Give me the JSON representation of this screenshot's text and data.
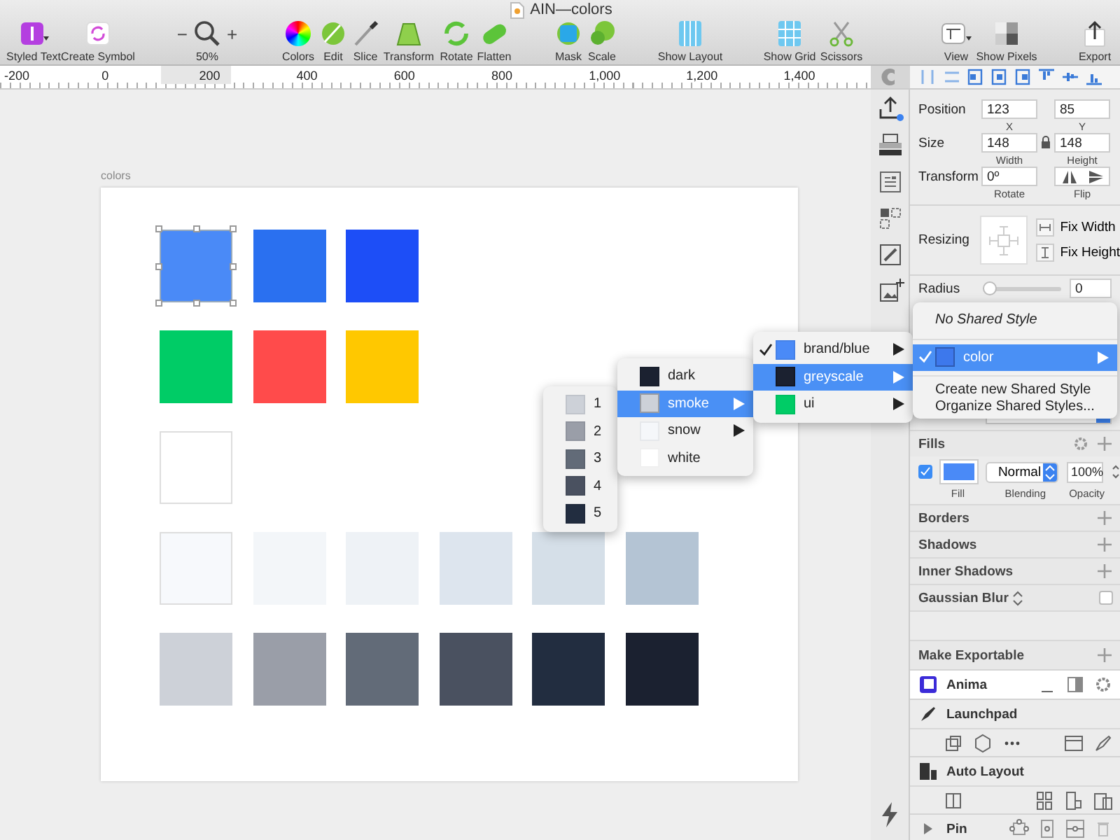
{
  "window": {
    "title": "AIN—colors"
  },
  "toolbar": [
    {
      "kind": "styled-text",
      "label": "Styled Text"
    },
    {
      "kind": "symbol",
      "label": "Create Symbol"
    },
    {
      "kind": "zoom",
      "label": "50%",
      "minus": "−",
      "plus": "+"
    },
    {
      "kind": "colors",
      "label": "Colors"
    },
    {
      "kind": "edit",
      "label": "Edit"
    },
    {
      "kind": "slice",
      "label": "Slice"
    },
    {
      "kind": "transform",
      "label": "Transform"
    },
    {
      "kind": "rotate",
      "label": "Rotate"
    },
    {
      "kind": "flatten",
      "label": "Flatten"
    },
    {
      "kind": "mask",
      "label": "Mask"
    },
    {
      "kind": "scale",
      "label": "Scale"
    },
    {
      "kind": "layout",
      "label": "Show Layout"
    },
    {
      "kind": "grid",
      "label": "Show Grid"
    },
    {
      "kind": "scissors",
      "label": "Scissors"
    },
    {
      "kind": "view",
      "label": "View"
    },
    {
      "kind": "pixels",
      "label": "Show Pixels"
    },
    {
      "kind": "export",
      "label": "Export"
    }
  ],
  "ruler": {
    "labels": [
      "-200",
      "0",
      "200",
      "400",
      "600",
      "800",
      "1,000",
      "1,200",
      "1,400"
    ]
  },
  "artboard": {
    "title": "colors",
    "rows": [
      {
        "swatches": [
          {
            "color": "#4a8af7",
            "selected": true
          },
          {
            "color": "#2a70f0",
            "selected": false
          },
          {
            "color": "#1d4ef7",
            "selected": false
          }
        ]
      },
      {
        "swatches": [
          {
            "color": "#00cc66",
            "selected": false
          },
          {
            "color": "#ff4b4b",
            "selected": false
          },
          {
            "color": "#ffc800",
            "selected": false
          }
        ]
      },
      {
        "swatches": [
          {
            "color": "#ffffff",
            "selected": false
          }
        ]
      },
      {
        "swatches": [
          {
            "color": "#f7f9fc",
            "selected": false
          },
          {
            "color": "#f3f6f9",
            "selected": false
          },
          {
            "color": "#eef2f6",
            "selected": false
          },
          {
            "color": "#dde5ee",
            "selected": false
          },
          {
            "color": "#d5dfe8",
            "selected": false
          },
          {
            "color": "#b4c4d4",
            "selected": false
          }
        ]
      },
      {
        "swatches": [
          {
            "color": "#cdd1d8",
            "selected": false
          },
          {
            "color": "#9a9ea8",
            "selected": false
          },
          {
            "color": "#626b78",
            "selected": false
          },
          {
            "color": "#4a5160",
            "selected": false
          },
          {
            "color": "#222d40",
            "selected": false
          },
          {
            "color": "#1b2130",
            "selected": false
          }
        ]
      }
    ]
  },
  "menus": [
    {
      "items": [
        {
          "kind": "color",
          "label": "1",
          "color": "#cdd1d8",
          "checked": false,
          "selected": false,
          "submenu": false
        },
        {
          "kind": "color",
          "label": "2",
          "color": "#9a9ea8",
          "checked": false,
          "selected": false,
          "submenu": false
        },
        {
          "kind": "color",
          "label": "3",
          "color": "#626b78",
          "checked": false,
          "selected": false,
          "submenu": false
        },
        {
          "kind": "color",
          "label": "4",
          "color": "#4a5160",
          "checked": false,
          "selected": false,
          "submenu": false
        },
        {
          "kind": "color",
          "label": "5",
          "color": "#222d40",
          "checked": false,
          "selected": false,
          "submenu": false
        }
      ]
    },
    {
      "items": [
        {
          "kind": "color",
          "label": "dark",
          "color": "#1b2130",
          "checked": false,
          "selected": false,
          "submenu": false
        },
        {
          "kind": "color",
          "label": "smoke",
          "color": "#cdd1d8",
          "checked": false,
          "selected": true,
          "submenu": true
        },
        {
          "kind": "color",
          "label": "snow",
          "color": "#f5f7fa",
          "checked": false,
          "selected": false,
          "submenu": true
        },
        {
          "kind": "color",
          "label": "white",
          "color": "#ffffff",
          "checked": false,
          "selected": false,
          "submenu": false
        }
      ]
    },
    {
      "items": [
        {
          "kind": "color",
          "label": "brand/blue",
          "color": "#4a8af7",
          "checked": true,
          "selected": false,
          "submenu": true
        },
        {
          "kind": "color",
          "label": "greyscale",
          "color": "#1b2130",
          "checked": false,
          "selected": true,
          "submenu": true
        },
        {
          "kind": "color",
          "label": "ui",
          "color": "#00cc66",
          "checked": false,
          "selected": false,
          "submenu": true
        }
      ]
    },
    {
      "items": [
        {
          "kind": "header",
          "label": "No Shared Style",
          "checked": false,
          "selected": false,
          "submenu": false
        },
        {
          "kind": "color",
          "label": "color",
          "color": "#3d78ec",
          "checked": true,
          "selected": true,
          "submenu": true
        },
        {
          "kind": "action",
          "label": "Create new Shared Style",
          "checked": false,
          "selected": false,
          "submenu": false
        },
        {
          "kind": "action",
          "label": "Organize Shared Styles...",
          "checked": false,
          "selected": false,
          "submenu": false
        }
      ]
    }
  ],
  "inspector": {
    "position": {
      "label": "Position",
      "x": {
        "value": "123",
        "caption": "X"
      },
      "y": {
        "value": "85",
        "caption": "Y"
      }
    },
    "size": {
      "label": "Size",
      "width": {
        "value": "148",
        "caption": "Width"
      },
      "height": {
        "value": "148",
        "caption": "Height"
      },
      "locked": true
    },
    "transform": {
      "label": "Transform",
      "rotate": {
        "value": "0º",
        "caption": "Rotate"
      },
      "flip_caption": "Flip"
    },
    "resizing": {
      "label": "Resizing",
      "fix_width": "Fix Width",
      "fix_height": "Fix Height"
    },
    "radius": {
      "label": "Radius",
      "level": 0,
      "value": "0"
    },
    "fills": {
      "title": "Fills",
      "checked": true,
      "color": "#4a8af7",
      "blending": "Normal",
      "opacity": "100%",
      "captions": [
        "Fill",
        "Blending",
        "Opacity"
      ]
    },
    "sections": [
      {
        "kind": "add",
        "title": "Borders"
      },
      {
        "kind": "add",
        "title": "Shadows"
      },
      {
        "kind": "add",
        "title": "Inner Shadows"
      },
      {
        "kind": "toggle",
        "title": "Gaussian Blur",
        "checked": false
      }
    ],
    "export": {
      "title": "Make Exportable"
    },
    "plugins": [
      {
        "kind": "anima",
        "title": "Anima"
      },
      {
        "kind": "launchpad",
        "title": "Launchpad"
      },
      {
        "kind": "auto-layout",
        "title": "Auto Layout"
      },
      {
        "kind": "pin",
        "title": "Pin"
      }
    ]
  }
}
